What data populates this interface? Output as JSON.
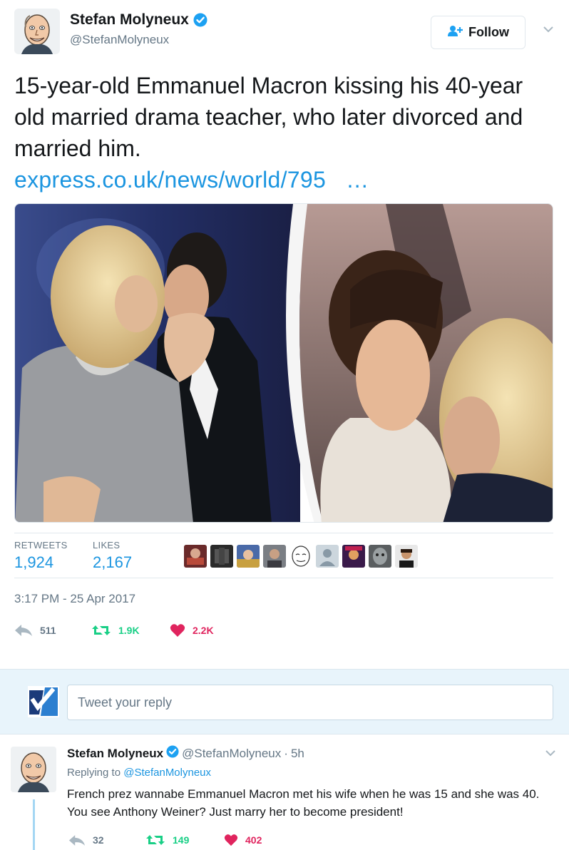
{
  "author": {
    "name": "Stefan Molyneux",
    "handle": "@StefanMolyneux"
  },
  "follow_label": "Follow",
  "tweet": {
    "text": "15-year-old Emmanuel Macron kissing his 40-year old married drama teacher, who later divorced and married him.",
    "link": "express.co.uk/news/world/795",
    "link_ellipsis": "…",
    "retweets_label": "RETWEETS",
    "retweets": "1,924",
    "likes_label": "LIKES",
    "likes": "2,167",
    "timestamp": "3:17 PM - 25 Apr 2017",
    "reply_count": "511",
    "retweet_count": "1.9K",
    "like_count": "2.2K"
  },
  "reply_box": {
    "placeholder": "Tweet your reply"
  },
  "reply": {
    "name": "Stefan Molyneux",
    "handle": "@StefanMolyneux",
    "dot": "·",
    "time": "5h",
    "replying_prefix": "Replying to",
    "replying_to": "@StefanMolyneux",
    "text": "French prez wannabe Emmanuel Macron met his wife when he was 15 and she was 40. You see Anthony Weiner? Just marry her to become president!",
    "reply_count": "32",
    "retweet_count": "149",
    "like_count": "402"
  },
  "colors": {
    "link": "#1b95e0",
    "retweet": "#19cf86",
    "like": "#e0245e",
    "muted": "#657786",
    "verified": "#1da1f2"
  },
  "icons": [
    "verified-badge-icon",
    "follow-person-icon",
    "chevron-down-icon",
    "reply-icon",
    "retweet-icon",
    "heart-icon"
  ]
}
